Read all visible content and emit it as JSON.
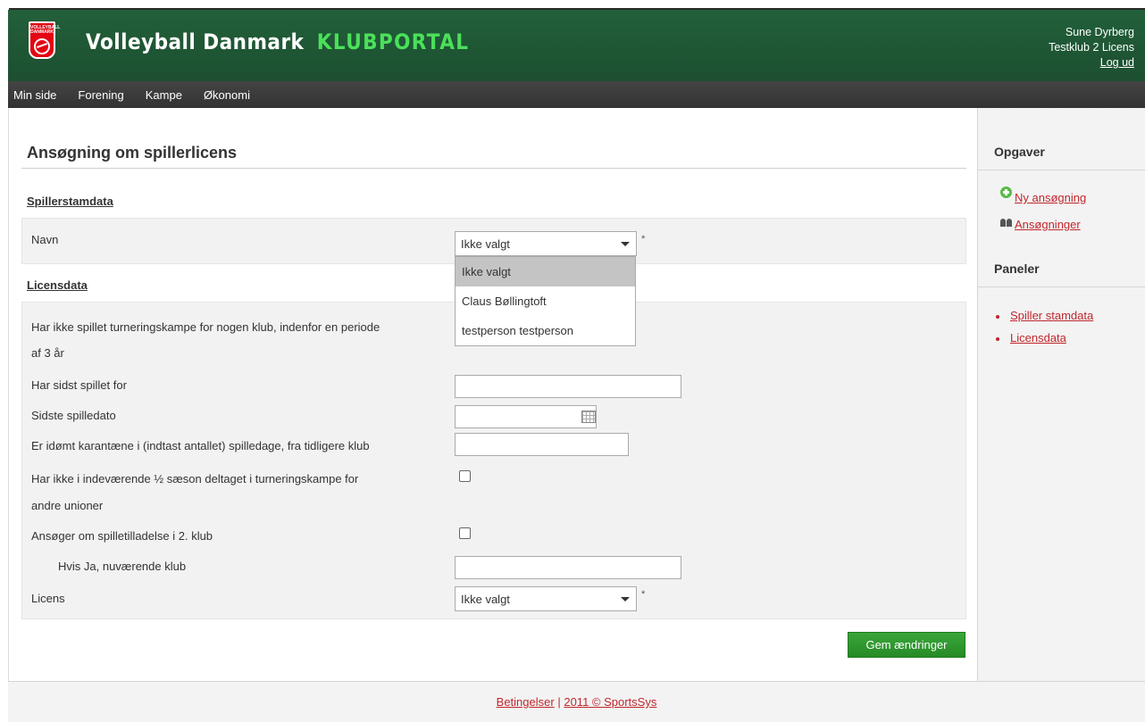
{
  "header": {
    "logo_text": "VOLLEYBALL DANMARK",
    "brand_name": "Volleyball Danmark",
    "brand_accent": "KLUBPORTAL",
    "user_name": "Sune Dyrberg",
    "club_name": "Testklub 2 Licens",
    "logout": "Log ud"
  },
  "nav": {
    "items": [
      "Min side",
      "Forening",
      "Kampe",
      "Økonomi"
    ]
  },
  "main": {
    "title": "Ansøgning om spillerlicens",
    "section1": {
      "heading": "Spillerstamdata",
      "name_label": "Navn",
      "name_value": "Ikke valgt",
      "required": "*"
    },
    "dropdown_options": [
      "Ikke valgt",
      "Claus Bøllingtoft",
      "testperson testperson"
    ],
    "section2": {
      "heading": "Licensdata",
      "q1_line1": "Har ikke spillet turneringskampe for nogen klub, indenfor en periode",
      "q1_line2": "af 3 år",
      "last_club_label": "Har sidst spillet for",
      "last_club_value": "",
      "last_date_label": "Sidste spilledato",
      "last_date_value": "",
      "quarantine_label": "Er idømt karantæne i (indtast antallet) spilledage, fra tidligere klub",
      "quarantine_value": "",
      "half_season_line1": "Har ikke i indeværende ½ sæson deltaget i turneringskampe for",
      "half_season_line2": "andre unioner",
      "half_season_checked": false,
      "second_club_label": "Ansøger om spilletilladelse i 2. klub",
      "second_club_checked": false,
      "current_club_label": "Hvis Ja, nuværende klub",
      "current_club_value": "",
      "license_label": "Licens",
      "license_value": "Ikke valgt",
      "required": "*"
    },
    "save_button": "Gem ændringer"
  },
  "sidebar": {
    "tasks_title": "Opgaver",
    "tasks": [
      "Ny ansøgning",
      "Ansøgninger"
    ],
    "panels_title": "Paneler",
    "panels": [
      "Spiller stamdata",
      "Licensdata"
    ]
  },
  "footer": {
    "terms": "Betingelser",
    "separator": "|",
    "copyright": "2011 © SportsSys"
  },
  "colors": {
    "header_green": "#1e5631",
    "accent_green": "#4be05a",
    "nav_dark": "#3b3b3b",
    "link_red": "#c0272d",
    "button_green": "#2e9c2e"
  },
  "icons": [
    "plus-circle-icon",
    "group-icon",
    "calendar-icon",
    "chevron-down-icon"
  ]
}
